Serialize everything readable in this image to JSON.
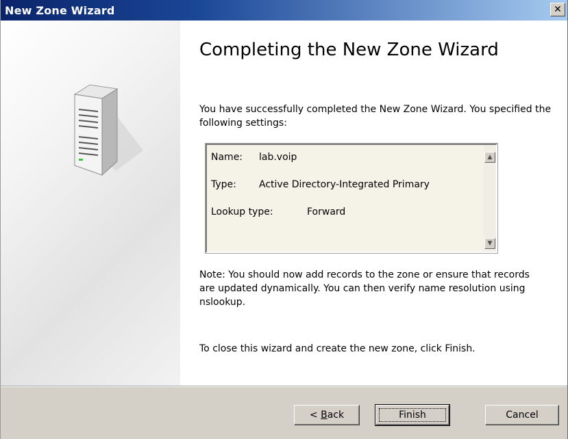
{
  "window": {
    "title": "New Zone Wizard",
    "close_glyph": "✕"
  },
  "content": {
    "heading": "Completing the New Zone Wizard",
    "intro": "You have successfully completed the New Zone Wizard. You specified the following settings:",
    "settings": [
      {
        "label": "Name:",
        "value": "lab.voip"
      },
      {
        "label": "Type:",
        "value": "Active Directory-Integrated Primary"
      },
      {
        "label": "Lookup type:",
        "value": "Forward"
      }
    ],
    "note": "Note: You should now add records to the zone or ensure that records are updated dynamically. You can then verify name resolution using nslookup.",
    "close_instructions": "To close this wizard and create the new zone, click Finish."
  },
  "buttons": {
    "back_prefix": "< ",
    "back_mnemonic": "B",
    "back_rest": "ack",
    "finish": "Finish",
    "cancel": "Cancel"
  },
  "icons": {
    "server": "server-icon",
    "scroll_up": "scroll-up-arrow-icon",
    "scroll_down": "scroll-down-arrow-icon"
  },
  "colors": {
    "titlebar_start": "#0a246a",
    "titlebar_end": "#a6caf0",
    "button_face": "#d4d0c8"
  }
}
